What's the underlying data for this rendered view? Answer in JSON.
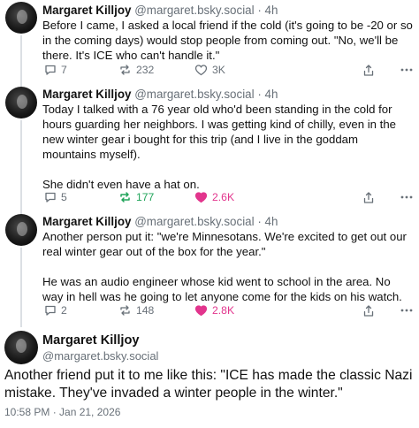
{
  "posts": [
    {
      "author": "Margaret Killjoy",
      "handle": "@margaret.bsky.social",
      "separator": "·",
      "time": "4h",
      "text": [
        "Before I came, I asked a local friend if the cold (it's going to be -20 or so in the coming days) would stop people from coming out. \"No, we'll be there. It's ICE who can't handle it.\""
      ],
      "replies": "7",
      "reposts": "232",
      "likes": "3K"
    },
    {
      "author": "Margaret Killjoy",
      "handle": "@margaret.bsky.social",
      "separator": "·",
      "time": "4h",
      "text": [
        "Today I talked with a 76 year old who'd been standing in the cold for hours guarding her neighbors. I was getting kind of chilly, even in the new winter gear i bought for this trip (and I live in the goddam mountains myself).",
        "She didn't even have a hat on."
      ],
      "replies": "5",
      "reposts": "177",
      "likes": "2.6K"
    },
    {
      "author": "Margaret Killjoy",
      "handle": "@margaret.bsky.social",
      "separator": "·",
      "time": "4h",
      "text": [
        "Another person put it: \"we're Minnesotans. We're excited to get out our real winter gear out of the box for the year.\"",
        "He was an audio engineer whose kid went to school in the area. No way in hell was he going to let anyone come for the kids on his watch."
      ],
      "replies": "2",
      "reposts": "148",
      "likes": "2.8K"
    }
  ],
  "main_post": {
    "author": "Margaret Killjoy",
    "handle": "@margaret.bsky.social",
    "text": "Another friend put it to me like this: \"ICE has made the classic Nazi mistake. They've invaded a winter people in the winter.\"",
    "timestamp": "10:58 PM · Jan 21, 2026"
  },
  "colors": {
    "like_active": "#e2358d",
    "repost_active": "#20a45a",
    "muted": "#687078",
    "thread_line": "#dcdfe4"
  },
  "icons": [
    "reply-icon",
    "repost-icon",
    "like-icon",
    "share-icon",
    "more-icon"
  ]
}
